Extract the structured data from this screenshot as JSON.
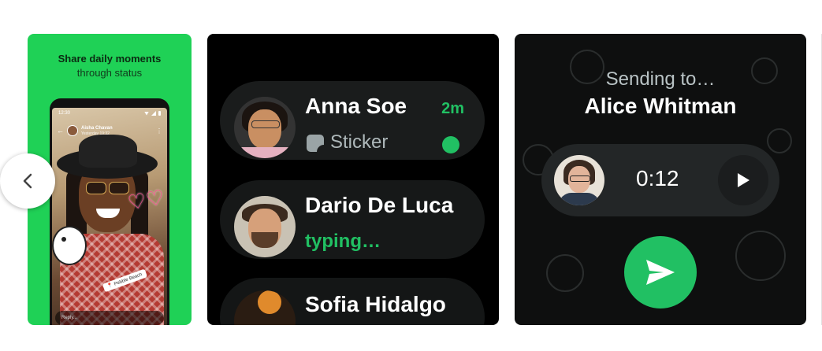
{
  "carousel": {
    "prev_icon": "chevron-left-icon",
    "cards": [
      {
        "title": "Share daily moments",
        "subtitle": "through status",
        "phone": {
          "time": "12:30",
          "story_name": "Aisha Chavan",
          "story_time": "Yesterday 19:32",
          "location_tag": "Pebble Beach",
          "reply_placeholder": "Reply..."
        },
        "accent_color": "#1fd156"
      },
      {
        "chats": [
          {
            "name": "Anna Soe",
            "time": "2m",
            "preview_icon": "sticker-icon",
            "preview": "Sticker",
            "unread": true
          },
          {
            "name": "Dario De Luca",
            "status": "typing…"
          },
          {
            "name": "Sofia Hidalgo"
          }
        ],
        "accent_color": "#21c063"
      },
      {
        "sending_label": "Sending to…",
        "recipient": "Alice Whitman",
        "voice_duration": "0:12",
        "play_icon": "play-icon",
        "send_icon": "send-icon",
        "accent_color": "#21c063"
      }
    ]
  }
}
